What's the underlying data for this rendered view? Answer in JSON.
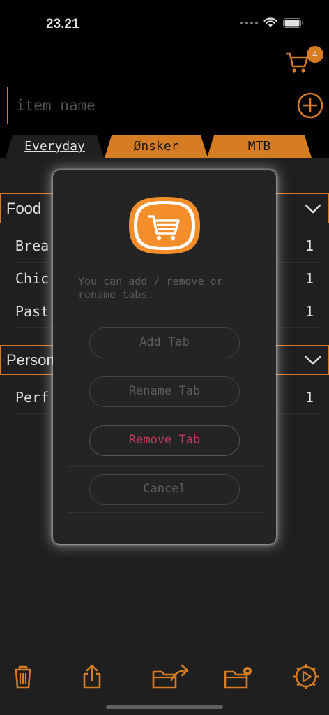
{
  "status_bar": {
    "time": "23.21"
  },
  "header": {
    "cart_count": "4"
  },
  "input": {
    "placeholder": "item name"
  },
  "tabs": [
    {
      "label": "Everyday",
      "active": true
    },
    {
      "label": "Ønsker",
      "active": false
    },
    {
      "label": "MTB",
      "active": false
    }
  ],
  "sections": [
    {
      "title": "Food",
      "items": [
        {
          "name": "Brea",
          "qty": "1"
        },
        {
          "name": "Chic",
          "qty": "1"
        },
        {
          "name": "Past",
          "qty": "1"
        }
      ]
    },
    {
      "title": "Person",
      "items": [
        {
          "name": "Perf",
          "qty": "1"
        }
      ]
    }
  ],
  "dialog": {
    "message": "You can add / remove or rename tabs.",
    "buttons": {
      "add": "Add Tab",
      "rename": "Rename Tab",
      "remove": "Remove Tab",
      "cancel": "Cancel"
    }
  },
  "toolbar": {
    "icons": [
      "trash-icon",
      "share-icon",
      "folder-move-icon",
      "folder-settings-icon",
      "settings-icon"
    ]
  },
  "colors": {
    "accent": "#f38e2b",
    "panel": "#242424",
    "danger": "#c83a5c",
    "muted_text": "#5c5c5c"
  }
}
